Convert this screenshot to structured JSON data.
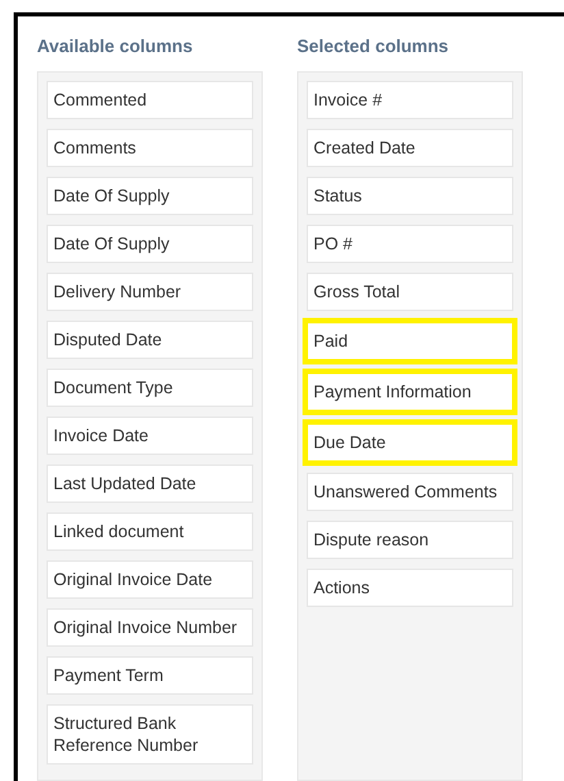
{
  "available_columns": {
    "title": "Available columns",
    "items": [
      {
        "label": "Commented",
        "highlighted": false
      },
      {
        "label": "Comments",
        "highlighted": false
      },
      {
        "label": "Date Of Supply",
        "highlighted": false
      },
      {
        "label": "Date Of Supply",
        "highlighted": false
      },
      {
        "label": "Delivery Number",
        "highlighted": false
      },
      {
        "label": "Disputed Date",
        "highlighted": false
      },
      {
        "label": "Document Type",
        "highlighted": false
      },
      {
        "label": "Invoice Date",
        "highlighted": false
      },
      {
        "label": "Last Updated Date",
        "highlighted": false
      },
      {
        "label": "Linked document",
        "highlighted": false
      },
      {
        "label": "Original Invoice Date",
        "highlighted": false
      },
      {
        "label": "Original Invoice Number",
        "highlighted": false
      },
      {
        "label": "Payment Term",
        "highlighted": false
      },
      {
        "label": "Structured Bank Reference Number",
        "highlighted": false
      }
    ]
  },
  "selected_columns": {
    "title": "Selected columns",
    "items": [
      {
        "label": "Invoice #",
        "highlighted": false
      },
      {
        "label": "Created Date",
        "highlighted": false
      },
      {
        "label": "Status",
        "highlighted": false
      },
      {
        "label": "PO #",
        "highlighted": false
      },
      {
        "label": "Gross Total",
        "highlighted": false
      },
      {
        "label": "Paid",
        "highlighted": true
      },
      {
        "label": "Payment Information",
        "highlighted": true
      },
      {
        "label": "Due Date",
        "highlighted": true
      },
      {
        "label": "Unanswered Comments",
        "highlighted": false
      },
      {
        "label": "Dispute reason",
        "highlighted": false
      },
      {
        "label": "Actions",
        "highlighted": false
      }
    ]
  }
}
